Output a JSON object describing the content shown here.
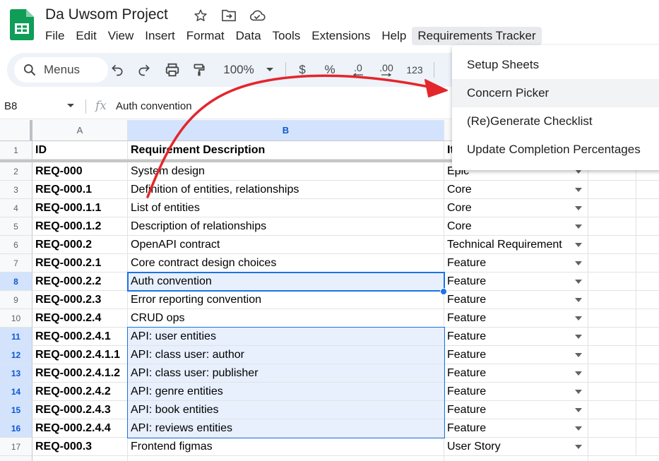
{
  "app": {
    "doc_title": "Da Uwsom Project",
    "title_icons": [
      "star-icon",
      "move-to-folder-icon",
      "cloud-status-icon"
    ]
  },
  "menubar": {
    "items": [
      "File",
      "Edit",
      "View",
      "Insert",
      "Format",
      "Data",
      "Tools",
      "Extensions",
      "Help",
      "Requirements Tracker"
    ]
  },
  "toolbar": {
    "search_label": "Menus",
    "zoom": "100%",
    "currency": "$",
    "percent": "%",
    "decrease_decimals": ".0",
    "increase_decimals": ".00",
    "number_format": "123"
  },
  "formula_bar": {
    "cell_ref": "B8",
    "fx": "fx",
    "content": "Auth convention"
  },
  "columns": [
    "A",
    "B",
    ""
  ],
  "rows": [
    {
      "num": "1",
      "id": "ID",
      "desc": "Requirement Description",
      "type": "It"
    },
    {
      "num": "2",
      "id": "REQ-000",
      "desc": "System design",
      "type": "Epic"
    },
    {
      "num": "3",
      "id": "REQ-000.1",
      "desc": "Definition of entities, relationships",
      "type": "Core"
    },
    {
      "num": "4",
      "id": "REQ-000.1.1",
      "desc": "List of entities",
      "type": "Core"
    },
    {
      "num": "5",
      "id": "REQ-000.1.2",
      "desc": "Description of relationships",
      "type": "Core"
    },
    {
      "num": "6",
      "id": "REQ-000.2",
      "desc": "OpenAPI contract",
      "type": "Technical Requirement"
    },
    {
      "num": "7",
      "id": "REQ-000.2.1",
      "desc": "Core contract design choices",
      "type": "Feature"
    },
    {
      "num": "8",
      "id": "REQ-000.2.2",
      "desc": "Auth convention",
      "type": "Feature"
    },
    {
      "num": "9",
      "id": "REQ-000.2.3",
      "desc": "Error reporting convention",
      "type": "Feature"
    },
    {
      "num": "10",
      "id": "REQ-000.2.4",
      "desc": "CRUD ops",
      "type": "Feature"
    },
    {
      "num": "11",
      "id": "REQ-000.2.4.1",
      "desc": "API: user entities",
      "type": "Feature"
    },
    {
      "num": "12",
      "id": "REQ-000.2.4.1.1",
      "desc": "API: class user: author",
      "type": "Feature"
    },
    {
      "num": "13",
      "id": "REQ-000.2.4.1.2",
      "desc": "API: class user: publisher",
      "type": "Feature"
    },
    {
      "num": "14",
      "id": "REQ-000.2.4.2",
      "desc": "API: genre entities",
      "type": "Feature"
    },
    {
      "num": "15",
      "id": "REQ-000.2.4.3",
      "desc": "API: book entities",
      "type": "Feature"
    },
    {
      "num": "16",
      "id": "REQ-000.2.4.4",
      "desc": "API: reviews entities",
      "type": "Feature"
    },
    {
      "num": "17",
      "id": "REQ-000.3",
      "desc": "Frontend figmas",
      "type": "User Story"
    }
  ],
  "selection": {
    "active_cell": "B8",
    "range": "B11:B16"
  },
  "requirements_menu": {
    "items": [
      "Setup Sheets",
      "Concern Picker",
      "(Re)Generate Checklist",
      "Update Completion Percentages"
    ],
    "highlighted": "Concern Picker"
  },
  "colors": {
    "accent": "#1a73e8",
    "selection_fill": "#e8f0fe",
    "header_selected": "#d3e3fd",
    "annotation_arrow": "#e3262b",
    "sheets_green": "#0f9d58"
  }
}
